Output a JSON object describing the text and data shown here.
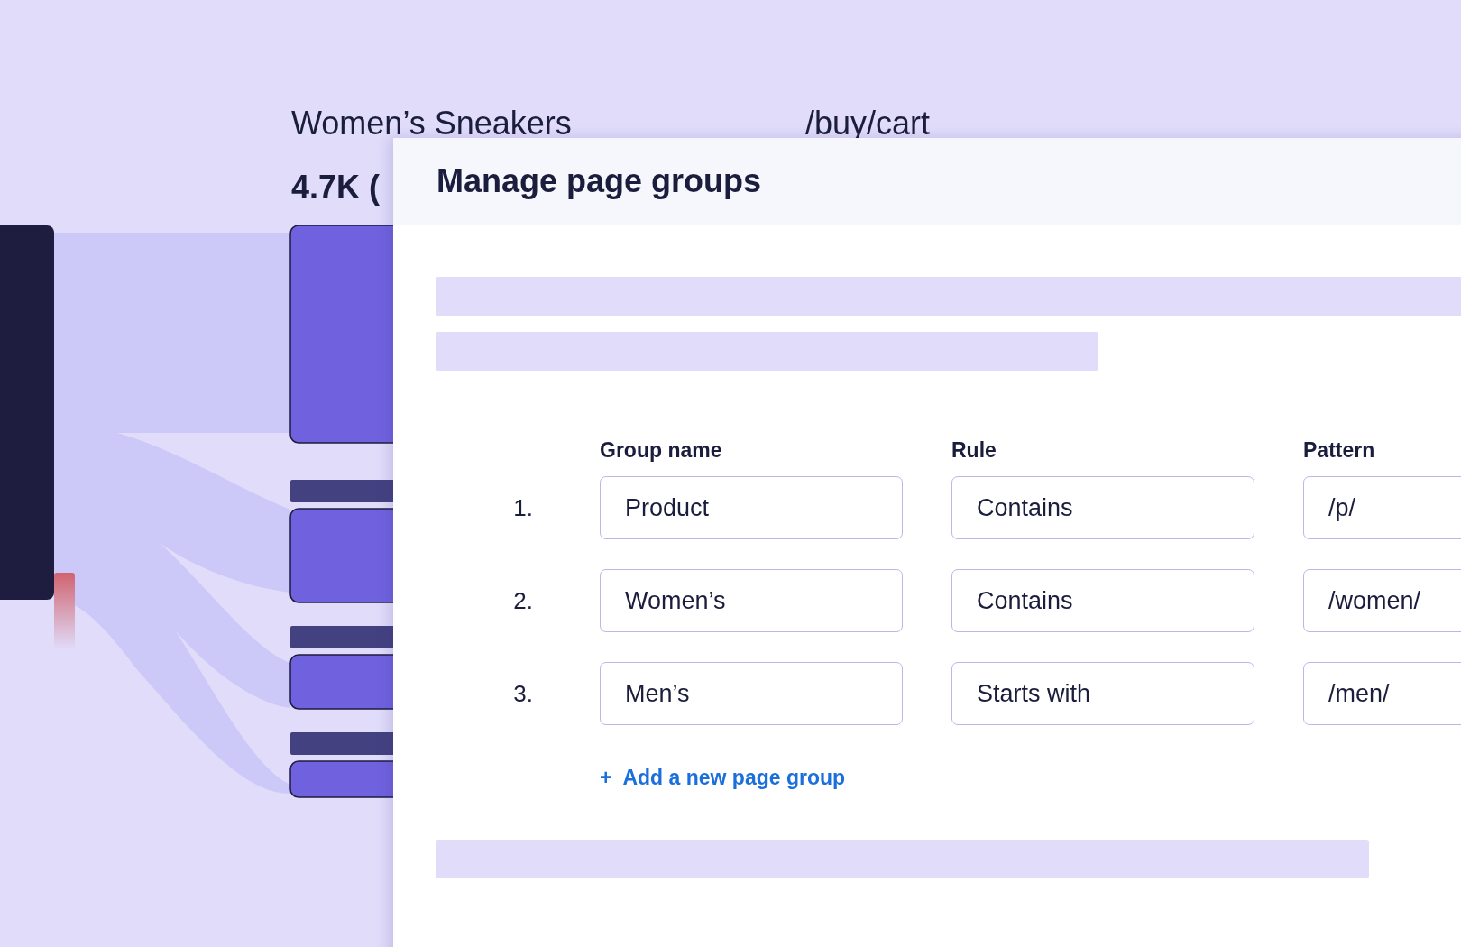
{
  "background": {
    "node_label": "Women’s Sneakers",
    "path_label": "/buy/cart",
    "count": "4.7K ("
  },
  "dialog": {
    "title": "Manage page groups",
    "columns": [
      "Group name",
      "Rule",
      "Pattern"
    ],
    "rows": [
      {
        "number": "1.",
        "group_name": "Product",
        "rule": "Contains",
        "pattern": "/p/"
      },
      {
        "number": "2.",
        "group_name": "Women’s",
        "rule": "Contains",
        "pattern": "/women/"
      },
      {
        "number": "3.",
        "group_name": "Men’s",
        "rule": "Starts with",
        "pattern": "/men/"
      }
    ],
    "add_link": {
      "icon": "+",
      "label": "Add a new page group"
    }
  }
}
